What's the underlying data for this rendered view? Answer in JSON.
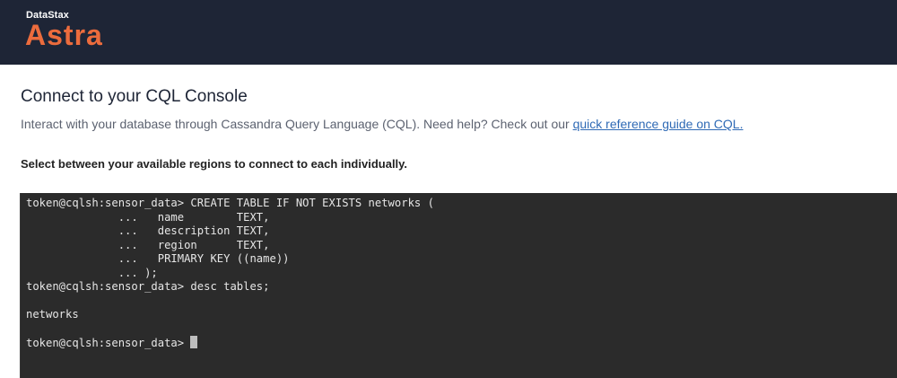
{
  "header": {
    "brand_small": "DataStax",
    "brand_large": "Astra"
  },
  "main": {
    "title": "Connect to your CQL Console",
    "subtitle_text": "Interact with your database through Cassandra Query Language (CQL). Need help? Check out our ",
    "subtitle_link": "quick reference guide on CQL.",
    "regions_text": "Select between your available regions to connect to each individually."
  },
  "console": {
    "lines": [
      "token@cqlsh:sensor_data> CREATE TABLE IF NOT EXISTS networks (",
      "              ...   name        TEXT,",
      "              ...   description TEXT,",
      "              ...   region      TEXT,",
      "              ...   PRIMARY KEY ((name))",
      "              ... );",
      "token@cqlsh:sensor_data> desc tables;",
      "",
      "networks",
      ""
    ],
    "prompt": "token@cqlsh:sensor_data> "
  },
  "colors": {
    "header_bg": "#1e2536",
    "brand_orange": "#ec6c3d",
    "link_blue": "#2f6ab5",
    "console_bg": "#2b2b2b"
  }
}
